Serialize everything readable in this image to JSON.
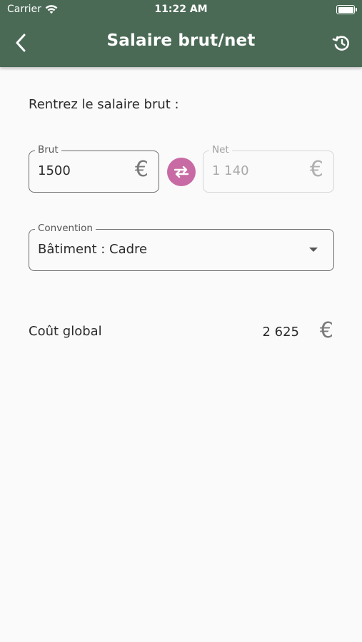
{
  "status_bar": {
    "carrier": "Carrier",
    "time": "11:22 AM"
  },
  "nav": {
    "title": "Salaire brut/net",
    "back_icon": "chevron-left-icon",
    "history_icon": "history-icon"
  },
  "form": {
    "prompt": "Rentrez le salaire brut :",
    "gross": {
      "label": "Brut",
      "value": "1500",
      "currency_symbol": "€"
    },
    "net": {
      "label": "Net",
      "value": "1 140",
      "currency_symbol": "€"
    },
    "swap_icon": "swap-arrows-icon",
    "convention": {
      "label": "Convention",
      "selected": "Bâtiment : Cadre"
    }
  },
  "result": {
    "label": "Coût global",
    "value": "2 625",
    "currency_symbol": "€"
  },
  "colors": {
    "header": "#4a6a55",
    "accent": "#c86aa4",
    "background": "#fafafa"
  }
}
